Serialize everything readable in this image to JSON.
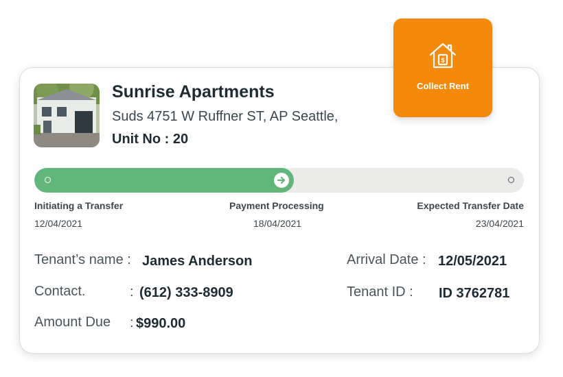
{
  "property": {
    "name": "Sunrise Apartments",
    "address": "Suds 4751 W Ruffner ST, AP Seattle,",
    "unit": "Unit No : 20",
    "photo_icon": "house-photo"
  },
  "action": {
    "label": "Collect Rent",
    "icon": "house-dollar-icon",
    "color": "#f48a0c"
  },
  "progress": {
    "fraction": 0.53,
    "fill_color": "#62b67c",
    "steps": [
      {
        "label": "Initiating a Transfer",
        "date": "12/04/2021"
      },
      {
        "label": "Payment Processing",
        "date": "18/04/2021"
      },
      {
        "label": "Expected Transfer Date",
        "date": "23/04/2021"
      }
    ]
  },
  "details": {
    "tenant_name_label": "Tenant’s name :",
    "tenant_name": "James Anderson",
    "contact_label": "Contact.",
    "contact_colon": ":",
    "contact": "(612) 333-8909",
    "amount_label": "Amount Due",
    "amount_colon": ":",
    "amount": "$990.00",
    "arrival_label": "Arrival Date :",
    "arrival": "12/05/2021",
    "tenant_id_label": "Tenant ID :",
    "tenant_id": "ID 3762781"
  }
}
